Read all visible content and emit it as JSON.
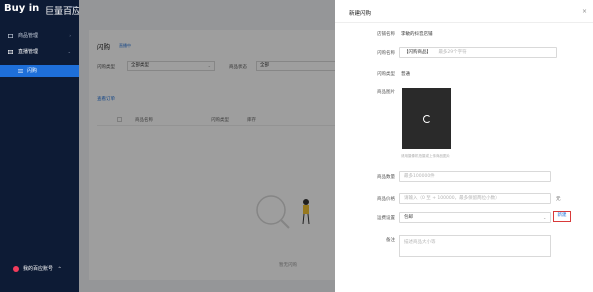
{
  "sidebar": {
    "logo_main": "Buy in",
    "logo_sub": "巨量百应",
    "logo_tag": "BETA",
    "items": [
      {
        "label": "商品管理",
        "icon": "goods-icon"
      },
      {
        "label": "直播管理",
        "icon": "live-icon"
      },
      {
        "label": "闪购",
        "icon": "list-icon"
      }
    ],
    "account_label": "我的百应账号"
  },
  "main": {
    "title": "闪购",
    "title_hint": "直播中",
    "filters": [
      {
        "label": "闪购类型",
        "value": "全部类型"
      },
      {
        "label": "商品状态",
        "value": "全部"
      }
    ],
    "view_link": "查看订单",
    "table_headers": [
      "商品名称",
      "闪购类型",
      "库存"
    ],
    "empty_text": "暂无闪购"
  },
  "drawer": {
    "title": "新建闪购",
    "close": "×",
    "fields": {
      "shop_name_label": "店铺名称",
      "shop_name_value": "李敏的抖音店铺",
      "product_name_label": "闪购名称",
      "product_name_value": "【闪购商品】",
      "product_name_placeholder": "最多29个字符",
      "type_label": "闪购类型",
      "type_value": "普通",
      "image_label": "商品图片",
      "image_hint": "请用摄像机拍摄或上传商品图片",
      "quantity_label": "商品数量",
      "quantity_placeholder": "最多100000件",
      "price_label": "商品价格",
      "price_placeholder": "请输入（0 至 + 100000，最多保留两位小数）",
      "price_unit": "元",
      "freight_label": "运费设置",
      "freight_value": "包邮",
      "new_button": "新建",
      "remark_label": "备注",
      "remark_placeholder": "描述商品大小等"
    }
  }
}
